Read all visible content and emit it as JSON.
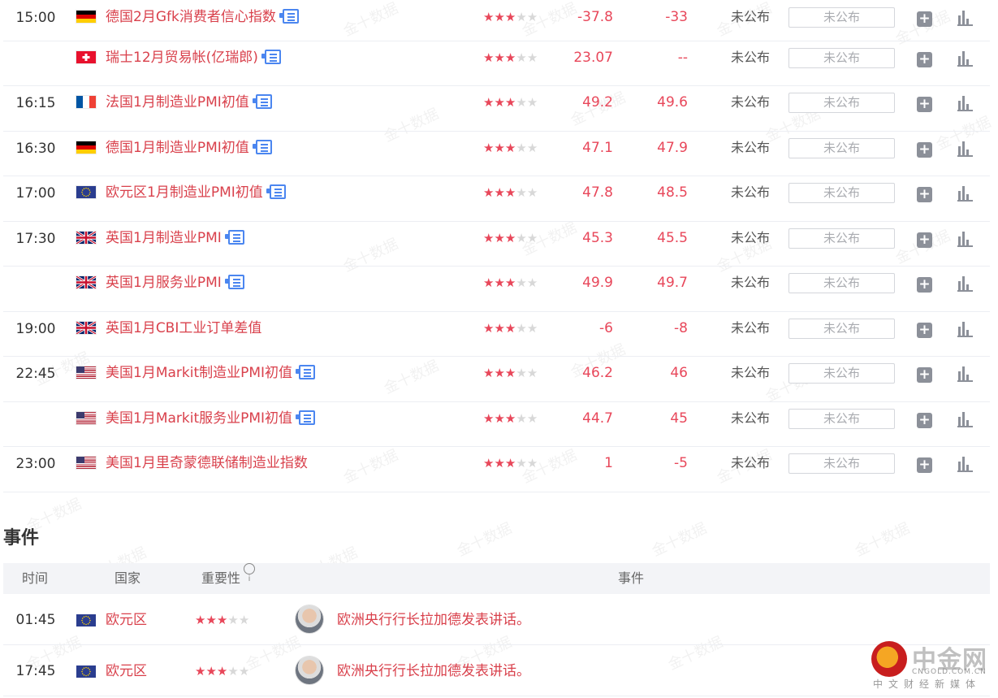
{
  "colors": {
    "accent_red": "#d9414c",
    "star_on": "#e8475a",
    "star_off": "#d8d8d8",
    "header_bg": "#f3f4f7"
  },
  "indicators": [
    {
      "time": "15:00",
      "flag": "germany-flag",
      "name": "德国2月Gfk消费者信心指数",
      "has_doc": true,
      "stars": 3,
      "prev": "-37.8",
      "forecast": "-33",
      "actual": "未公布",
      "actual_box": "未公布"
    },
    {
      "time": "",
      "flag": "switzerland-flag",
      "name": "瑞士12月贸易帐(亿瑞郎)",
      "has_doc": true,
      "stars": 3,
      "prev": "23.07",
      "forecast": "--",
      "actual": "未公布",
      "actual_box": "未公布"
    },
    {
      "time": "16:15",
      "flag": "france-flag",
      "name": "法国1月制造业PMI初值",
      "has_doc": true,
      "stars": 3,
      "prev": "49.2",
      "forecast": "49.6",
      "actual": "未公布",
      "actual_box": "未公布"
    },
    {
      "time": "16:30",
      "flag": "germany-flag",
      "name": "德国1月制造业PMI初值",
      "has_doc": true,
      "stars": 3,
      "prev": "47.1",
      "forecast": "47.9",
      "actual": "未公布",
      "actual_box": "未公布"
    },
    {
      "time": "17:00",
      "flag": "eu-flag",
      "name": "欧元区1月制造业PMI初值",
      "has_doc": true,
      "stars": 3,
      "prev": "47.8",
      "forecast": "48.5",
      "actual": "未公布",
      "actual_box": "未公布"
    },
    {
      "time": "17:30",
      "flag": "uk-flag",
      "name": "英国1月制造业PMI",
      "has_doc": true,
      "stars": 3,
      "prev": "45.3",
      "forecast": "45.5",
      "actual": "未公布",
      "actual_box": "未公布"
    },
    {
      "time": "",
      "flag": "uk-flag",
      "name": "英国1月服务业PMI",
      "has_doc": true,
      "stars": 3,
      "prev": "49.9",
      "forecast": "49.7",
      "actual": "未公布",
      "actual_box": "未公布"
    },
    {
      "time": "19:00",
      "flag": "uk-flag",
      "name": "英国1月CBI工业订单差值",
      "has_doc": false,
      "stars": 3,
      "prev": "-6",
      "forecast": "-8",
      "actual": "未公布",
      "actual_box": "未公布"
    },
    {
      "time": "22:45",
      "flag": "us-flag",
      "name": "美国1月Markit制造业PMI初值",
      "has_doc": true,
      "stars": 3,
      "prev": "46.2",
      "forecast": "46",
      "actual": "未公布",
      "actual_box": "未公布"
    },
    {
      "time": "",
      "flag": "us-flag",
      "name": "美国1月Markit服务业PMI初值",
      "has_doc": true,
      "stars": 3,
      "prev": "44.7",
      "forecast": "45",
      "actual": "未公布",
      "actual_box": "未公布"
    },
    {
      "time": "23:00",
      "flag": "us-flag",
      "name": "美国1月里奇蒙德联储制造业指数",
      "has_doc": false,
      "stars": 3,
      "prev": "1",
      "forecast": "-5",
      "actual": "未公布",
      "actual_box": "未公布"
    }
  ],
  "events_section": {
    "title": "事件",
    "headers": {
      "time": "时间",
      "country": "国家",
      "importance": "重要性",
      "event": "事件"
    },
    "rows": [
      {
        "time": "01:45",
        "flag": "eu-flag",
        "country": "欧元区",
        "stars": 3,
        "text": "欧洲央行行长拉加德发表讲话。"
      },
      {
        "time": "17:45",
        "flag": "eu-flag",
        "country": "欧元区",
        "stars": 3,
        "text": "欧洲央行行长拉加德发表讲话。"
      }
    ]
  },
  "watermark_text": "金十数据",
  "logo": {
    "brand": "中金网",
    "url": "CNGOLD.COM.CN",
    "slogan": "中文财经新媒体"
  }
}
